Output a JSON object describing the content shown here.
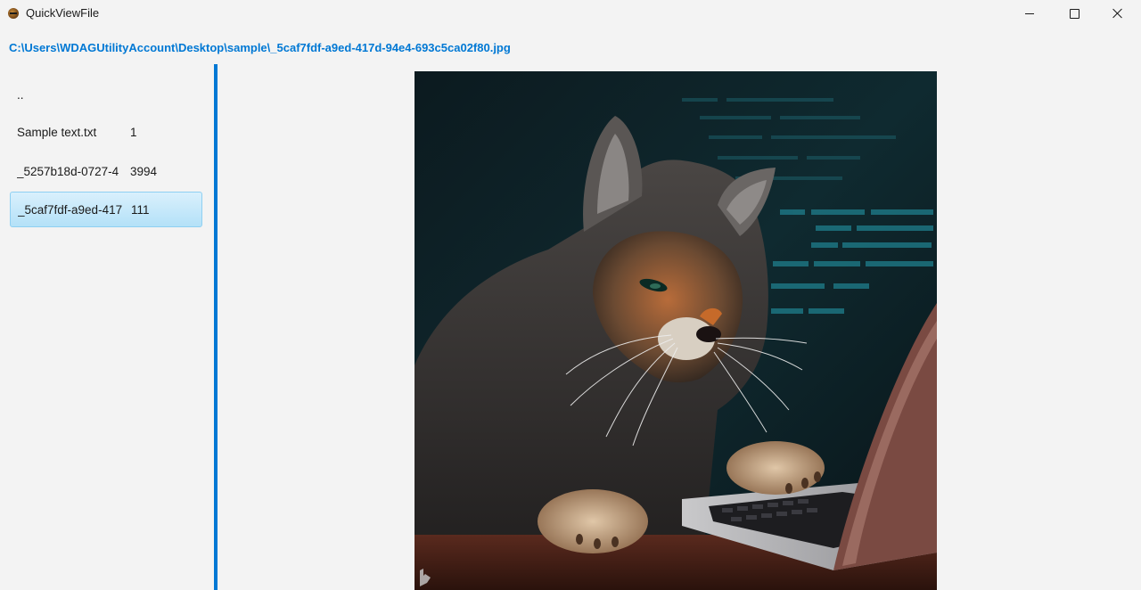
{
  "window": {
    "title": "QuickViewFile"
  },
  "path": "C:\\Users\\WDAGUtilityAccount\\Desktop\\sample\\_5caf7fdf-a9ed-417d-94e4-693c5ca02f80.jpg",
  "files": [
    {
      "name": "..",
      "size": ""
    },
    {
      "name": "Sample text.txt",
      "size": "1"
    },
    {
      "name": "_5257b18d-0727-4",
      "size": "3994"
    },
    {
      "name": "_5caf7fdf-a9ed-417",
      "size": "111",
      "selected": true
    }
  ],
  "preview": {
    "description_icon": "image-preview",
    "accent_color": "#0078d4"
  }
}
